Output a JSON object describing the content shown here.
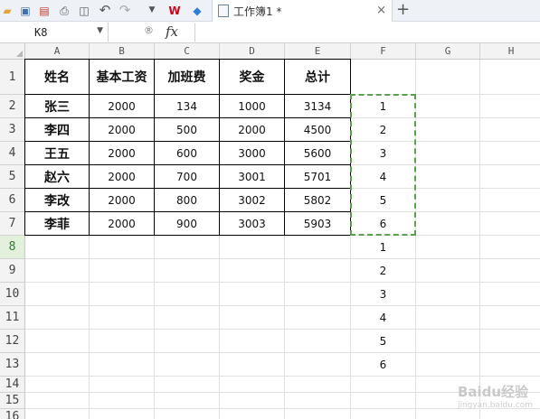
{
  "toolbar": {
    "icons": [
      "open-folder-icon",
      "save-icon",
      "export-pdf-icon",
      "print-icon",
      "print-preview-icon",
      "undo-icon",
      "redo-icon",
      "dropdown-icon",
      "wps-icon",
      "cube-icon"
    ],
    "tab": {
      "title": "工作簿1 *",
      "close": "×"
    },
    "new_tab": "+"
  },
  "formula_bar": {
    "name_box": "K8",
    "name_box_arrow": "▼",
    "zoom_glyph": "®",
    "fx_label": "fx",
    "formula": ""
  },
  "sheet": {
    "columns": [
      "A",
      "B",
      "C",
      "D",
      "E",
      "F",
      "G",
      "H"
    ],
    "rows": [
      "1",
      "2",
      "3",
      "4",
      "5",
      "6",
      "7",
      "8",
      "9",
      "10",
      "11",
      "12",
      "13",
      "14",
      "15",
      "16"
    ],
    "active_row": "8",
    "table_headers": [
      "姓名",
      "基本工资",
      "加班费",
      "奖金",
      "总计"
    ],
    "table_rows": [
      [
        "张三",
        "2000",
        "134",
        "1000",
        "3134"
      ],
      [
        "李四",
        "2000",
        "500",
        "2000",
        "4500"
      ],
      [
        "王五",
        "2000",
        "600",
        "3000",
        "5600"
      ],
      [
        "赵六",
        "2000",
        "700",
        "3001",
        "5701"
      ],
      [
        "李改",
        "2000",
        "800",
        "3002",
        "5802"
      ],
      [
        "李菲",
        "2000",
        "900",
        "3003",
        "5903"
      ]
    ],
    "column_f": [
      "",
      "1",
      "2",
      "3",
      "4",
      "5",
      "6",
      "1",
      "2",
      "3",
      "4",
      "5",
      "6",
      "",
      "",
      ""
    ]
  },
  "colors": {
    "copy_marquee": "#5aa04e",
    "active_row_header": "#e2f0dc"
  },
  "watermark": {
    "text": "Baidu经验",
    "sub": "jingyan.baidu.com"
  }
}
